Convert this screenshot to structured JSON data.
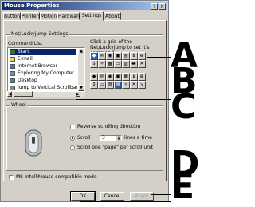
{
  "window": {
    "title": "Mouse Properties",
    "buttons": [
      "?",
      "X"
    ]
  },
  "tabs": [
    "Buttons",
    "Pointers",
    "Motion",
    "Hardware",
    "Settings",
    "About"
  ],
  "active_tab": "Settings",
  "netluckyjump": {
    "group_label": "Net/Luckyjump Settings",
    "command_list_label": "Command List",
    "instruction": "Click a grid of the Net/Luckyjump to set it's command",
    "commands": [
      "Start",
      "E-mail",
      "Internet Browser",
      "Exploring My Computer",
      "Desktop",
      "Jump to Vertical Scrollbar"
    ],
    "selected_command": "Start"
  },
  "wheel": {
    "group_label": "Wheel",
    "reverse_label": "Reverse scrolling direction",
    "scroll_label": "Scroll",
    "scroll_lines": "3",
    "lines_suffix": "lines a time",
    "page_label": "Scroll one \"page\" per scroll unit"
  },
  "ms_intellimouse": "MS-IntelliMouse compatible mode",
  "footer": {
    "ok": "OK",
    "cancel": "Cancel",
    "apply": "Apply"
  },
  "callouts": [
    "A",
    "B",
    "C",
    "D",
    "E"
  ]
}
